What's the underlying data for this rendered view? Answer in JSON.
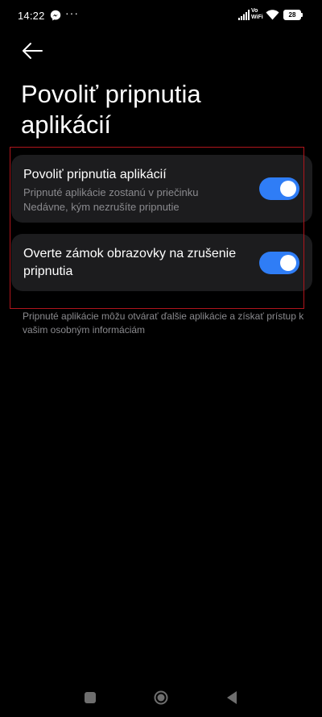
{
  "status_bar": {
    "time": "14:22",
    "notification_icon": "messenger-icon",
    "more_indicator": "···",
    "vowifi_line1": "Vo",
    "vowifi_line2": "WiFi",
    "battery_level": "28"
  },
  "header": {
    "back_icon": "arrow-left-icon",
    "title": "Povoliť pripnutia aplikácií"
  },
  "settings": [
    {
      "title": "Povoliť pripnutia aplikácií",
      "subtitle": "Pripnuté aplikácie zostanú v priečinku Nedávne, kým nezrušíte pripnutie",
      "enabled": true
    },
    {
      "title": "Overte zámok obrazovky na zrušenie pripnutia",
      "subtitle": "",
      "enabled": true
    }
  ],
  "footer_note": "Pripnuté aplikácie môžu otvárať ďalšie aplikácie a získať prístup k vašim osobným informáciám",
  "nav_bar": {
    "recents_icon": "square-icon",
    "home_icon": "circle-icon",
    "back_icon": "triangle-back-icon"
  },
  "colors": {
    "background": "#000000",
    "card": "#1c1c1e",
    "accent": "#2f7df6",
    "secondary_text": "#8a8a8e",
    "highlight_border": "#b0151c"
  }
}
